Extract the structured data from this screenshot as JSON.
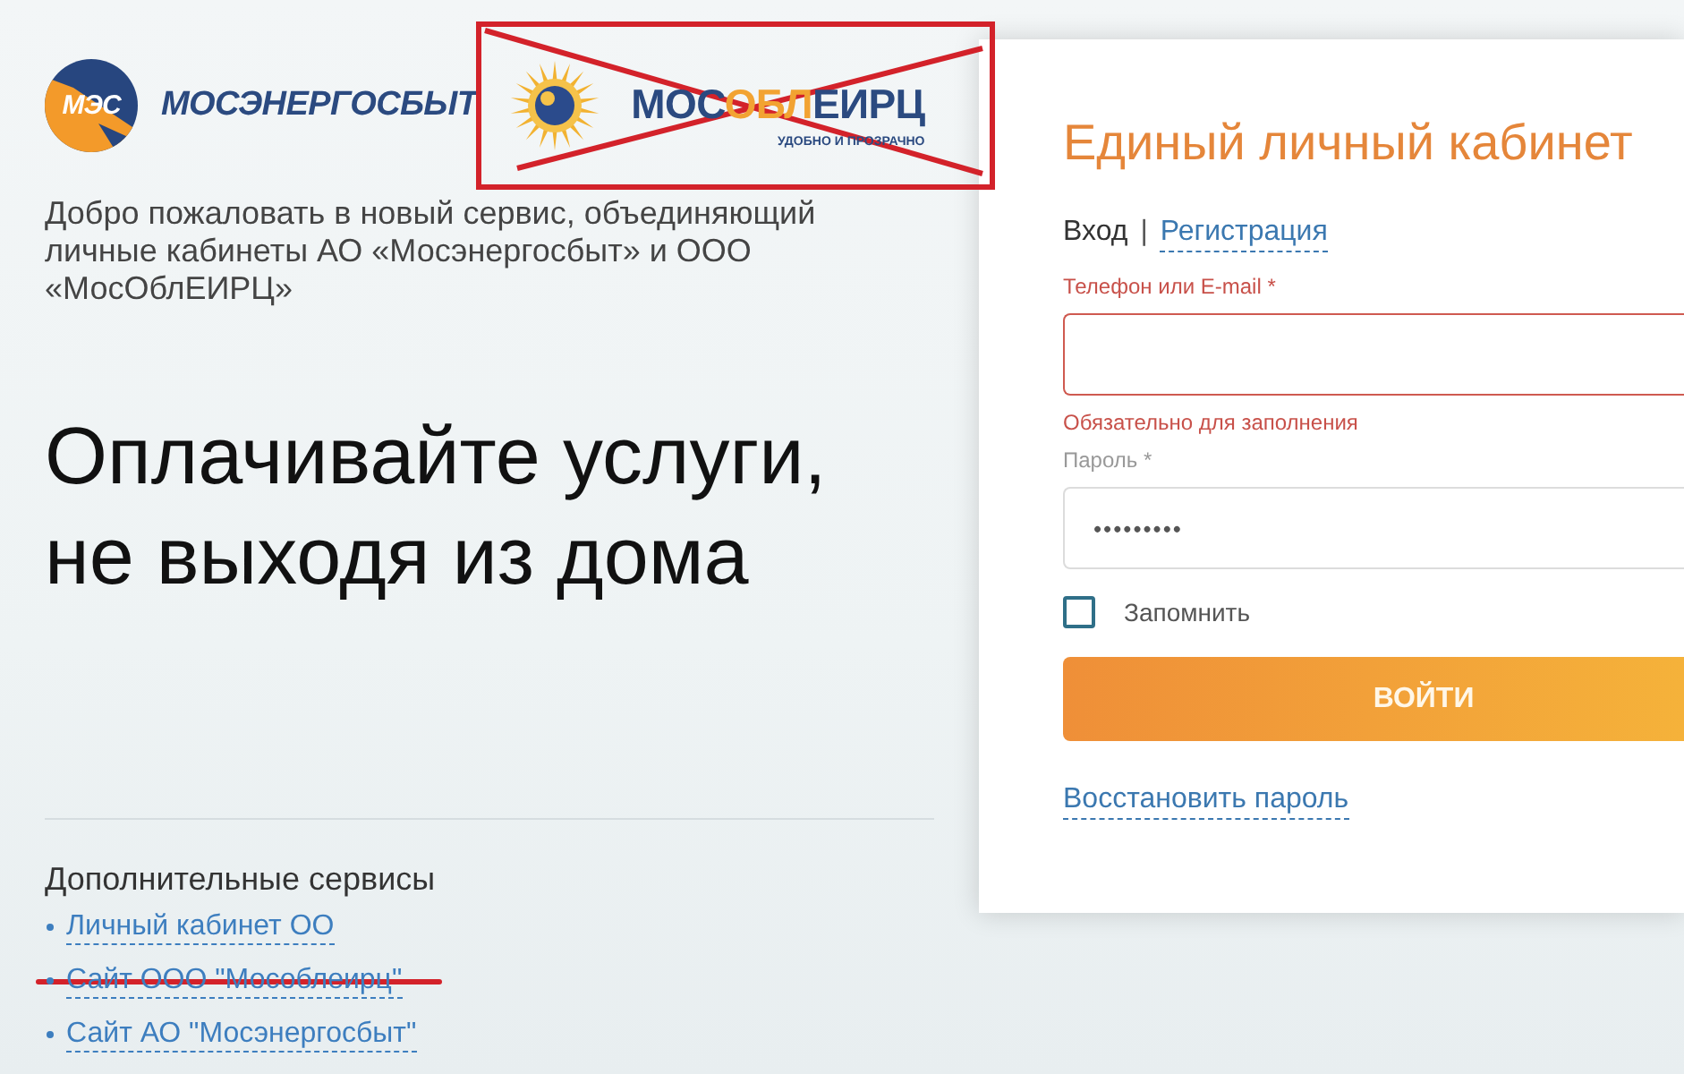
{
  "brand": {
    "emblem_text": "МЭС",
    "name": "МОСЭНЕРГОСБЫТ"
  },
  "partner_logo": {
    "wordmark_parts": [
      {
        "text": "МОС",
        "accent": false
      },
      {
        "text": "ОБЛ",
        "accent": true
      },
      {
        "text": "ЕИРЦ",
        "accent": false
      }
    ],
    "tagline": "УДОБНО И ПРОЗРАЧНО",
    "crossed_out": true
  },
  "welcome_text": "Добро пожаловать в новый сервис, объединяющий личные кабинеты АО «Мосэнергосбыт» и ООО «МосОблЕИРЦ»",
  "headline": "Оплачивайте услуги, не выходя из дома",
  "extra_services": {
    "title": "Дополнительные сервисы",
    "links": [
      {
        "label": "Личный кабинет ОО",
        "crossed_out": false
      },
      {
        "label": "Сайт ООО \"Мособлеирц\"",
        "crossed_out": true
      },
      {
        "label": "Сайт АО \"Мосэнергосбыт\"",
        "crossed_out": false
      }
    ]
  },
  "login": {
    "title": "Единый личный кабинет",
    "tabs": [
      {
        "label": "Вход",
        "selected": true
      },
      {
        "label": "Регистрация",
        "selected": false
      }
    ],
    "tab_separator": "|",
    "fields": [
      {
        "label": "Телефон или E-mail *",
        "invalid": true,
        "error": "Обязательно для заполнения"
      },
      {
        "label": "Пароль *",
        "invalid": false,
        "value": "•••••••••"
      }
    ],
    "remember": {
      "label": "Запомнить",
      "checked": false
    },
    "submit": "ВОЙТИ",
    "restore_link": "Восстановить пароль"
  }
}
